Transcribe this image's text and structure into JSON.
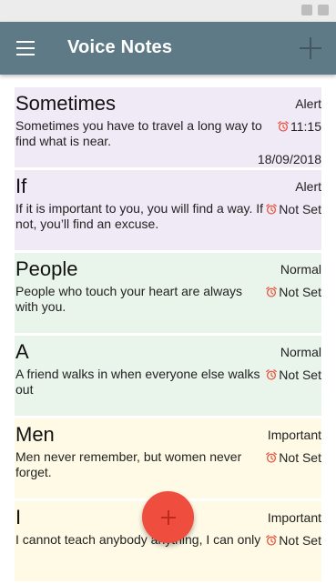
{
  "app": {
    "title": "Voice Notes"
  },
  "notes": [
    {
      "title": "Sometimes",
      "priority": "Alert",
      "body": "Sometimes you have to travel a long way to find what is near.",
      "alarm": "11:15",
      "date": "18/09/2018",
      "bg": "#f0e9f6"
    },
    {
      "title": "If",
      "priority": "Alert",
      "body": "If it is important to you, you will find a way. If not, you’ll find an excuse.",
      "alarm": "Not Set",
      "date": "",
      "bg": "#f0e9f6"
    },
    {
      "title": "People",
      "priority": "Normal",
      "body": "People who touch your heart are always with you.",
      "alarm": "Not Set",
      "date": "",
      "bg": "#e9f4ea"
    },
    {
      "title": "A",
      "priority": "Normal",
      "body": "A friend walks in when everyone else walks out",
      "alarm": "Not Set",
      "date": "",
      "bg": "#e9f4ea"
    },
    {
      "title": "Men",
      "priority": "Important",
      "body": "Men never remember, but women never forget.",
      "alarm": "Not Set",
      "date": "",
      "bg": "#fffae5"
    },
    {
      "title": "I",
      "priority": "Important",
      "body": "I cannot teach anybody anything, I can only",
      "alarm": "Not Set",
      "date": "",
      "bg": "#fffae5"
    }
  ],
  "colors": {
    "appbar": "#5f7a87",
    "fab": "#ef4d3e",
    "clock": "#e8533f"
  },
  "icons": {
    "menu": "menu-icon",
    "add": "add-icon",
    "alarm": "alarm-clock-icon",
    "fab": "plus-icon"
  }
}
